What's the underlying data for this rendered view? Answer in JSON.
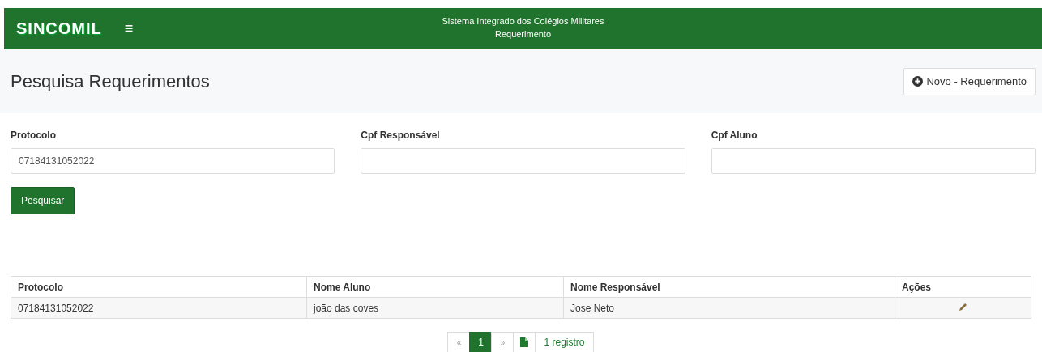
{
  "header": {
    "brand": "SINCOMIL",
    "menu_glyph": "≡",
    "title": "Sistema Integrado dos Colégios Militares",
    "subtitle": "Requerimento"
  },
  "page": {
    "title": "Pesquisa Requerimentos",
    "new_button": "Novo - Requerimento"
  },
  "filters": [
    {
      "label": "Protocolo",
      "value": "07184131052022"
    },
    {
      "label": "Cpf Responsável"
    },
    {
      "label": "Cpf Aluno"
    }
  ],
  "search_button": "Pesquisar",
  "table": {
    "columns": [
      "Protocolo",
      "Nome Aluno",
      "Nome Responsável",
      "Ações"
    ],
    "rows": [
      {
        "cells": [
          "07184131052022",
          "joão das coves",
          "Jose Neto"
        ]
      }
    ]
  },
  "pagination": {
    "prev": "«",
    "pages": [
      {
        "label": "1",
        "selected": true
      }
    ],
    "next": "»",
    "count": "1 registro"
  }
}
